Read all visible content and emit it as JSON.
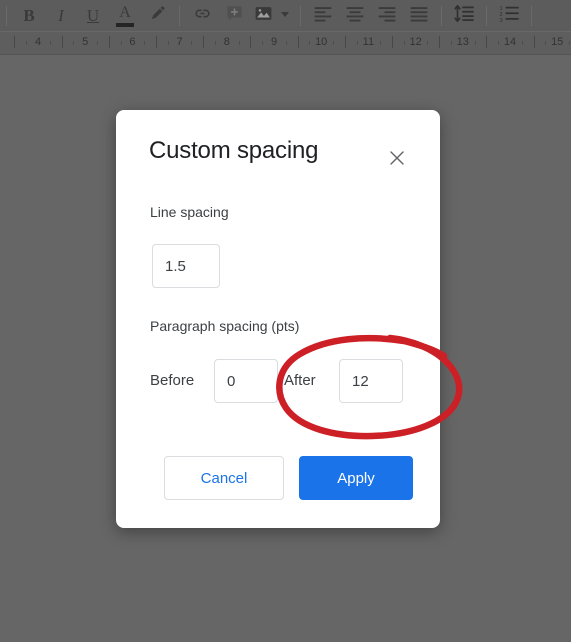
{
  "app": {
    "toolbar": {
      "groups": [
        {
          "name": "text-format",
          "items": [
            {
              "icon": "bold-icon",
              "label": "B"
            },
            {
              "icon": "italic-icon",
              "label": "I"
            },
            {
              "icon": "underline-icon",
              "label": "U"
            },
            {
              "icon": "text-color-icon",
              "label": "A"
            },
            {
              "icon": "highlight-pen-icon",
              "label": ""
            }
          ]
        },
        {
          "name": "insert",
          "items": [
            {
              "icon": "link-icon",
              "label": ""
            },
            {
              "icon": "add-comment-icon",
              "label": ""
            },
            {
              "icon": "insert-image-icon",
              "label": ""
            },
            {
              "icon": "chevron-down-icon",
              "label": ""
            }
          ]
        },
        {
          "name": "alignment",
          "items": [
            {
              "icon": "align-left-icon",
              "label": ""
            },
            {
              "icon": "align-center-icon",
              "label": ""
            },
            {
              "icon": "align-right-icon",
              "label": ""
            },
            {
              "icon": "align-justify-icon",
              "label": ""
            }
          ]
        },
        {
          "name": "spacing",
          "items": [
            {
              "icon": "line-spacing-icon",
              "label": ""
            }
          ]
        },
        {
          "name": "lists",
          "items": [
            {
              "icon": "numbered-list-icon",
              "label": ""
            }
          ]
        }
      ]
    },
    "ruler": {
      "numbers": [
        "4",
        "5",
        "6",
        "7",
        "8",
        "9",
        "10",
        "11",
        "12",
        "13",
        "14",
        "15"
      ]
    }
  },
  "dialog": {
    "title": "Custom spacing",
    "close_icon": "close-icon",
    "line_spacing": {
      "label": "Line spacing",
      "value": "1.5",
      "placeholder": ""
    },
    "paragraph_spacing": {
      "label": "Paragraph spacing (pts)",
      "before": {
        "label": "Before",
        "value": "0",
        "placeholder": ""
      },
      "after": {
        "label": "After",
        "value": "12",
        "placeholder": ""
      }
    },
    "buttons": {
      "cancel": "Cancel",
      "apply": "Apply"
    }
  },
  "annotation": {
    "type": "hand-drawn-ellipse",
    "color": "#CC2026",
    "target": "after-spacing-field"
  },
  "colors": {
    "accent": "#1a73e8",
    "dialog_background": "#ffffff",
    "overlay": "#666666",
    "annotation_red": "#CC2026",
    "input_border": "#dadce0",
    "text_primary": "#202124",
    "text_secondary": "#3c4043"
  }
}
